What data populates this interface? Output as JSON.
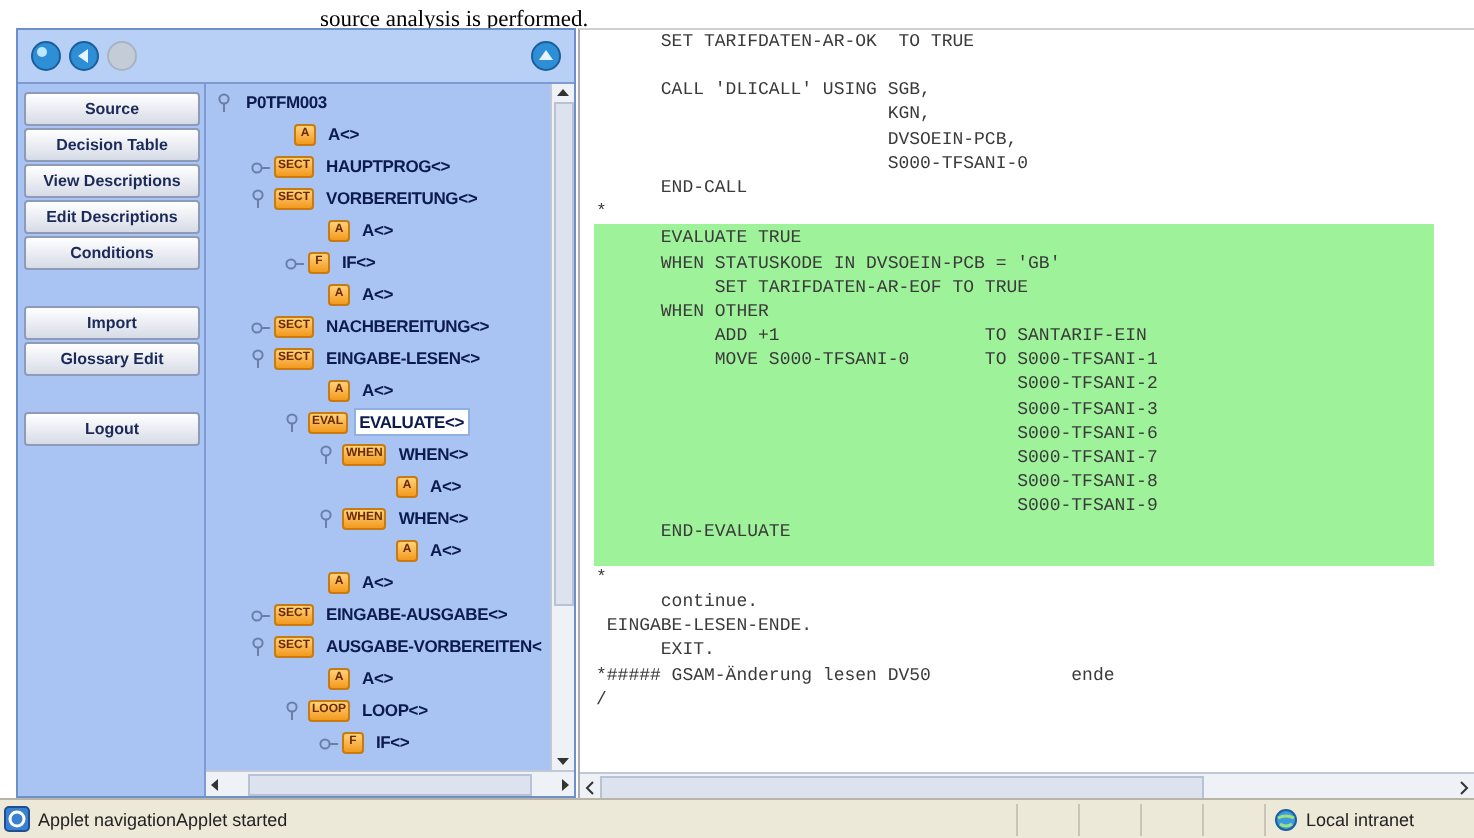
{
  "caption": "source analysis is performed.",
  "toolbar": {
    "buttons": [
      {
        "kind": "round",
        "disabled": false
      },
      {
        "kind": "back",
        "disabled": false
      },
      {
        "kind": "round",
        "disabled": true
      }
    ],
    "end_button": {
      "kind": "up",
      "disabled": false
    }
  },
  "nav_groups": [
    {
      "buttons": [
        "Source",
        "Decision Table",
        "View Descriptions",
        "Edit Descriptions",
        "Conditions"
      ]
    },
    {
      "buttons": [
        "Import",
        "Glossary Edit"
      ]
    },
    {
      "buttons": [
        "Logout"
      ]
    }
  ],
  "tree": {
    "label": "P0TFM003",
    "expanded": true,
    "selected": false,
    "children": [
      {
        "tag": "A",
        "label": "A<>",
        "selected": false
      },
      {
        "tag": "SECT",
        "label": "HAUPTPROG<>",
        "expanded": false,
        "selected": false
      },
      {
        "tag": "SECT",
        "label": "VORBEREITUNG<>",
        "expanded": true,
        "selected": false,
        "children": [
          {
            "tag": "A",
            "label": "A<>",
            "selected": false
          },
          {
            "tag": "F",
            "label": "IF<>",
            "expanded": false,
            "selected": false
          },
          {
            "tag": "A",
            "label": "A<>",
            "selected": false
          }
        ]
      },
      {
        "tag": "SECT",
        "label": "NACHBEREITUNG<>",
        "expanded": false,
        "selected": false
      },
      {
        "tag": "SECT",
        "label": "EINGABE-LESEN<>",
        "expanded": true,
        "selected": false,
        "children": [
          {
            "tag": "A",
            "label": "A<>",
            "selected": false
          },
          {
            "tag": "EVAL",
            "label": "EVALUATE<>",
            "expanded": true,
            "selected": true,
            "children": [
              {
                "tag": "WHEN",
                "label": "WHEN<>",
                "expanded": true,
                "selected": false,
                "children": [
                  {
                    "tag": "A",
                    "label": "A<>",
                    "selected": false
                  }
                ]
              },
              {
                "tag": "WHEN",
                "label": "WHEN<>",
                "expanded": true,
                "selected": false,
                "children": [
                  {
                    "tag": "A",
                    "label": "A<>",
                    "selected": false
                  }
                ]
              }
            ]
          },
          {
            "tag": "A",
            "label": "A<>",
            "selected": false
          }
        ]
      },
      {
        "tag": "SECT",
        "label": "EINGABE-AUSGABE<>",
        "expanded": false,
        "selected": false
      },
      {
        "tag": "SECT",
        "label": "AUSGABE-VORBEREITEN<",
        "expanded": true,
        "selected": false,
        "children": [
          {
            "tag": "A",
            "label": "A<>",
            "selected": false
          },
          {
            "tag": "LOOP",
            "label": "LOOP<>",
            "expanded": true,
            "selected": false,
            "children": [
              {
                "tag": "F",
                "label": "IF<>",
                "expanded": false,
                "selected": false
              }
            ]
          }
        ]
      }
    ]
  },
  "code": {
    "blocks": [
      {
        "highlighted": false,
        "lines": [
          "      SET TARIFDATEN-AR-OK  TO TRUE"
        ]
      },
      {
        "highlighted": false,
        "lines": [
          "      CALL 'DLICALL' USING SGB,",
          "                           KGN,",
          "                           DVSOEIN-PCB,",
          "                           S000-TFSANI-0",
          "      END-CALL",
          "*"
        ]
      },
      {
        "highlighted": true,
        "lines": [
          "      EVALUATE TRUE",
          "      WHEN STATUSKODE IN DVSOEIN-PCB = 'GB'",
          "           SET TARIFDATEN-AR-EOF TO TRUE",
          "      WHEN OTHER",
          "           ADD +1                   TO SANTARIF-EIN",
          "           MOVE S000-TFSANI-0       TO S000-TFSANI-1",
          "                                       S000-TFSANI-2",
          "                                       S000-TFSANI-3",
          "                                       S000-TFSANI-6",
          "                                       S000-TFSANI-7",
          "                                       S000-TFSANI-8",
          "                                       S000-TFSANI-9",
          "      END-EVALUATE"
        ]
      },
      {
        "highlighted": false,
        "lines": [
          "*",
          "      continue.",
          " EINGABE-LESEN-ENDE.",
          "      EXIT.",
          "*##### GSAM-Änderung lesen DV50             ende",
          "/"
        ]
      }
    ]
  },
  "status_bar": {
    "message": "Applet navigationApplet started",
    "zone": "Local intranet"
  }
}
